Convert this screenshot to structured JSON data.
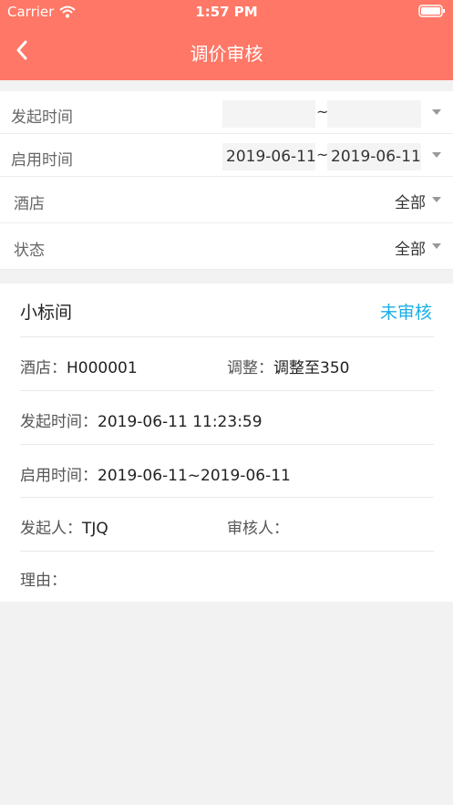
{
  "status_bar": {
    "carrier": "Carrier",
    "time": "1:57 PM"
  },
  "nav": {
    "title": "调价审核",
    "back_icon": "chevron-left-icon"
  },
  "filters": {
    "start_time": {
      "label": "发起时间",
      "from": "",
      "to": "",
      "separator": "~"
    },
    "enable_time": {
      "label": "启用时间",
      "from": "2019-06-11",
      "to": "2019-06-11",
      "separator": "~"
    },
    "hotel": {
      "label": "酒店",
      "value": "全部"
    },
    "status": {
      "label": "状态",
      "value": "全部"
    }
  },
  "record": {
    "room": "小标间",
    "status": "未审核",
    "hotel_label": "酒店：",
    "hotel_value": "H000001",
    "adjust_label": "调整：",
    "adjust_value": "调整至350",
    "initiated_time_label": "发起时间：",
    "initiated_time_value": "2019-06-11 11:23:59",
    "enable_time_label": "启用时间：",
    "enable_time_value": "2019-06-11~2019-06-11",
    "initiator_label": "发起人：",
    "initiator_value": "TJQ",
    "reviewer_label": "审核人：",
    "reviewer_value": "",
    "reason_label": "理由：",
    "reason_value": ""
  },
  "colors": {
    "header": "#ff7766",
    "accent": "#1aaee6"
  }
}
